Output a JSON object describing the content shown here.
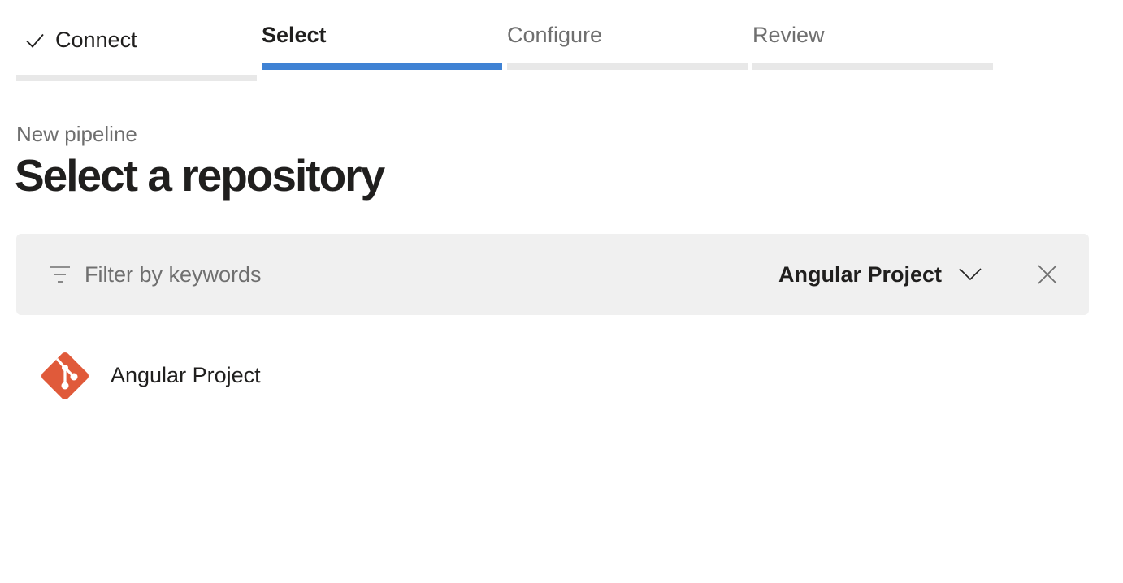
{
  "wizard": {
    "steps": [
      {
        "label": "Connect",
        "state": "completed",
        "icon": "check-icon"
      },
      {
        "label": "Select",
        "state": "active"
      },
      {
        "label": "Configure",
        "state": "upcoming"
      },
      {
        "label": "Review",
        "state": "upcoming"
      }
    ]
  },
  "header": {
    "subtitle": "New pipeline",
    "title": "Select a repository"
  },
  "filter": {
    "icon": "filter-icon",
    "placeholder": "Filter by keywords",
    "value": "",
    "project_selector": {
      "selected": "Angular Project",
      "icon": "chevron-down-icon"
    },
    "clear_icon": "close-icon"
  },
  "repositories": [
    {
      "name": "Angular Project",
      "icon": "git-repo-icon"
    }
  ],
  "colors": {
    "accent": "#3f82d4",
    "git_icon": "#e05a3a",
    "filter_background": "#f0f0f0",
    "muted_text": "#6f6f6f"
  }
}
